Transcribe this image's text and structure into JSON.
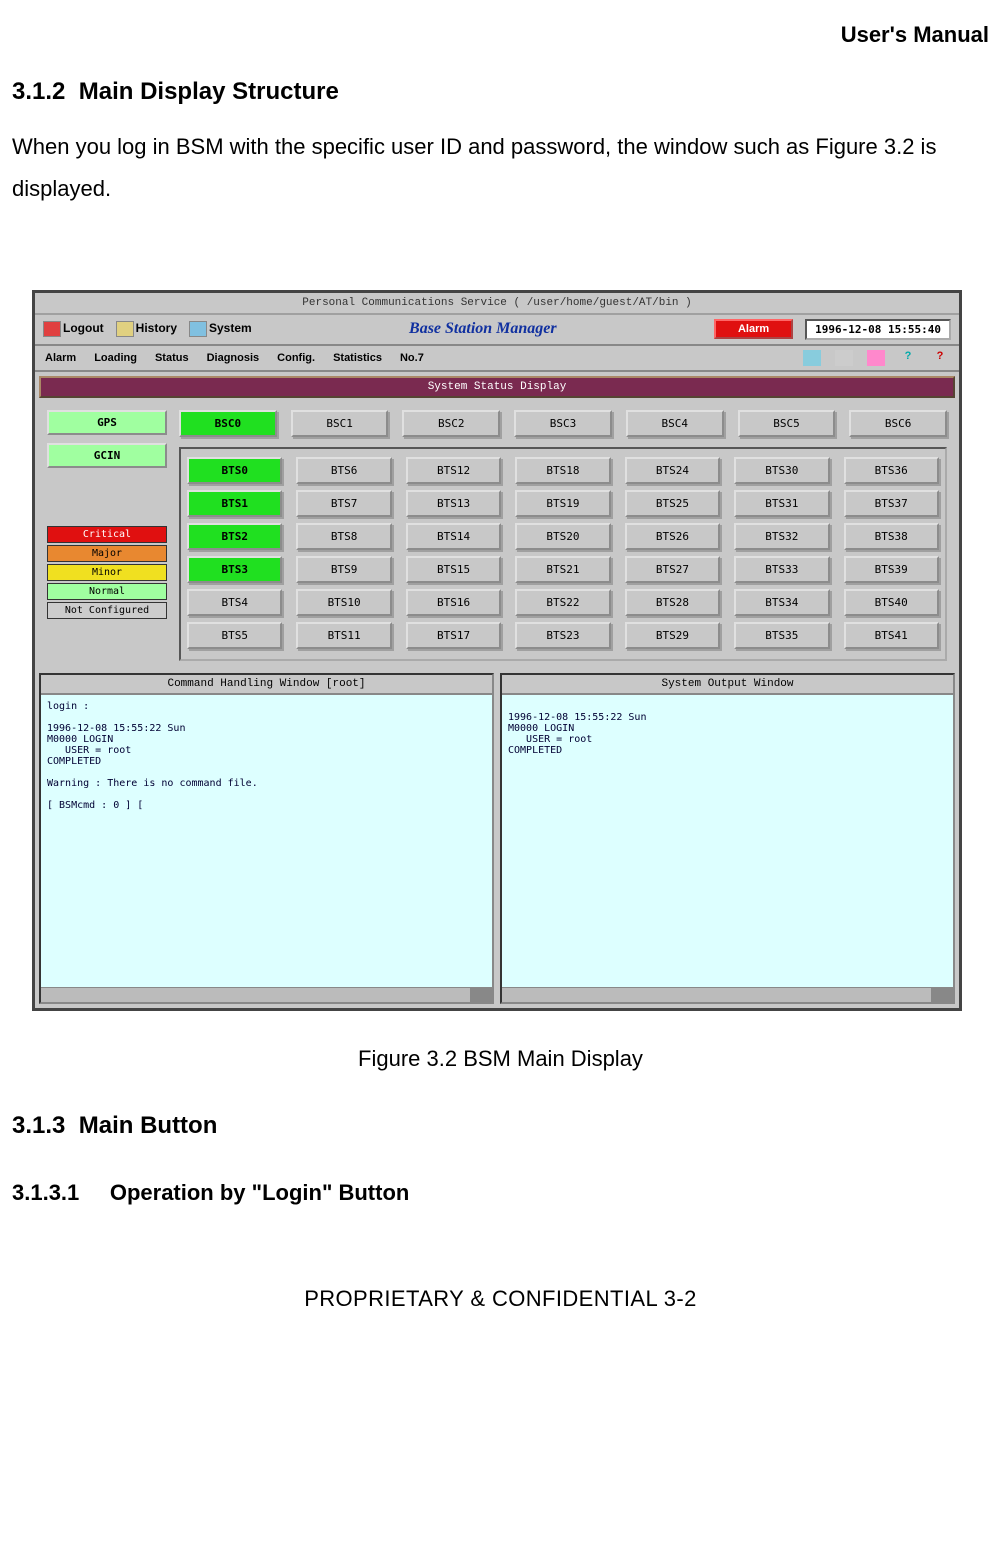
{
  "doc": {
    "running_header": "User's Manual",
    "h312_num": "3.1.2",
    "h312_title": "Main Display Structure",
    "para": "When you log in BSM with the specific user ID and password, the window such as Figure 3.2 is displayed.",
    "figcap": "Figure 3.2 BSM Main Display",
    "h313_num": "3.1.3",
    "h313_title": "Main Button",
    "h3131_num": "3.1.3.1",
    "h3131_title": "Operation by \"Login\" Button",
    "footer": "PROPRIETARY & CONFIDENTIAL                       3-2"
  },
  "app": {
    "title": "Personal Communications Service ( /user/home/guest/AT/bin )",
    "logout": "Logout",
    "history": "History",
    "system": "System",
    "brand": "Base Station Manager",
    "alarm": "Alarm",
    "timestamp": "1996-12-08 15:55:40",
    "menus": [
      "Alarm",
      "Loading",
      "Status",
      "Diagnosis",
      "Config.",
      "Statistics",
      "No.7"
    ],
    "sysbar": "System Status Display",
    "side": {
      "gps": "GPS",
      "gcin": "GCIN"
    },
    "legend": {
      "crit": "Critical",
      "maj": "Major",
      "min": "Minor",
      "nor": "Normal",
      "nc": "Not Configured"
    },
    "bsc": [
      "BSC0",
      "BSC1",
      "BSC2",
      "BSC3",
      "BSC4",
      "BSC5",
      "BSC6"
    ],
    "bts_cols": [
      [
        "BTS0",
        "BTS1",
        "BTS2",
        "BTS3",
        "BTS4",
        "BTS5"
      ],
      [
        "BTS6",
        "BTS7",
        "BTS8",
        "BTS9",
        "BTS10",
        "BTS11"
      ],
      [
        "BTS12",
        "BTS13",
        "BTS14",
        "BTS15",
        "BTS16",
        "BTS17"
      ],
      [
        "BTS18",
        "BTS19",
        "BTS20",
        "BTS21",
        "BTS22",
        "BTS23"
      ],
      [
        "BTS24",
        "BTS25",
        "BTS26",
        "BTS27",
        "BTS28",
        "BTS29"
      ],
      [
        "BTS30",
        "BTS31",
        "BTS32",
        "BTS33",
        "BTS34",
        "BTS35"
      ],
      [
        "BTS36",
        "BTS37",
        "BTS38",
        "BTS39",
        "BTS40",
        "BTS41"
      ]
    ],
    "pane1_title": "Command Handling Window [root]",
    "pane1_body": "login :\n\n1996-12-08 15:55:22 Sun\nM0000 LOGIN\n   USER = root\nCOMPLETED\n\nWarning : There is no command file.\n\n[ BSMcmd : 0 ] [",
    "pane2_title": "System Output Window",
    "pane2_body": "\n1996-12-08 15:55:22 Sun\nM0000 LOGIN\n   USER = root\nCOMPLETED"
  }
}
